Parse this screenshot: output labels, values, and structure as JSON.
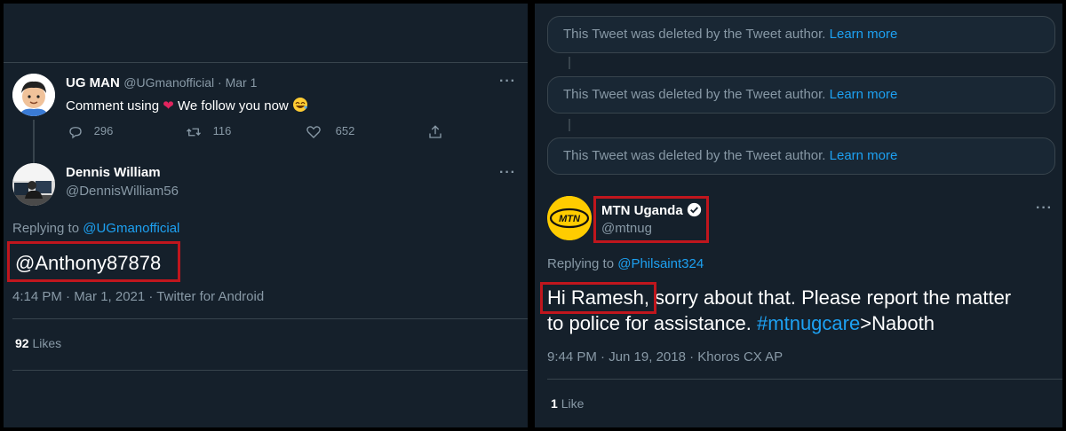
{
  "left_tweet": {
    "parent": {
      "name": "UG MAN",
      "meta": "@UGmanofficial · Mar 1",
      "text_before": "Comment using",
      "text_after": "We follow you now",
      "replies": "296",
      "retweets": "116",
      "likes": "652"
    },
    "reply": {
      "name": "Dennis William",
      "handle": "@DennisWilliam56",
      "replying_to_label": "Replying to",
      "replying_to": "@UGmanofficial",
      "text": "@Anthony87878",
      "timestamp": "4:14 PM · Mar 1, 2021 · Twitter for Android",
      "likes_count": "92",
      "likes_label": "Likes"
    }
  },
  "right_tweet": {
    "deleted_notices": [
      {
        "text": "This Tweet was deleted by the Tweet author.",
        "link": "Learn more"
      },
      {
        "text": "This Tweet was deleted by the Tweet author.",
        "link": "Learn more"
      },
      {
        "text": "This Tweet was deleted by the Tweet author.",
        "link": "Learn more"
      }
    ],
    "author": {
      "name": "MTN Uganda",
      "handle": "@mtnug",
      "logo_text": "MTN"
    },
    "replying_to_label": "Replying to",
    "replying_to": "@Philsaint324",
    "text_part1": "Hi Ramesh",
    "text_part2": ", sorry about that. Please report the matter",
    "text_part3": "to police for assistance.",
    "hashtag": "#mtnugcare",
    "text_part4": ">Naboth",
    "timestamp": "9:44 PM · Jun 19, 2018 · Khoros CX AP",
    "likes_count": "1",
    "likes_label": "Like"
  },
  "colors": {
    "background": "#15202b",
    "accent": "#1da1f2",
    "highlight_box": "#c0161d",
    "mtn_yellow": "#ffcc00"
  }
}
